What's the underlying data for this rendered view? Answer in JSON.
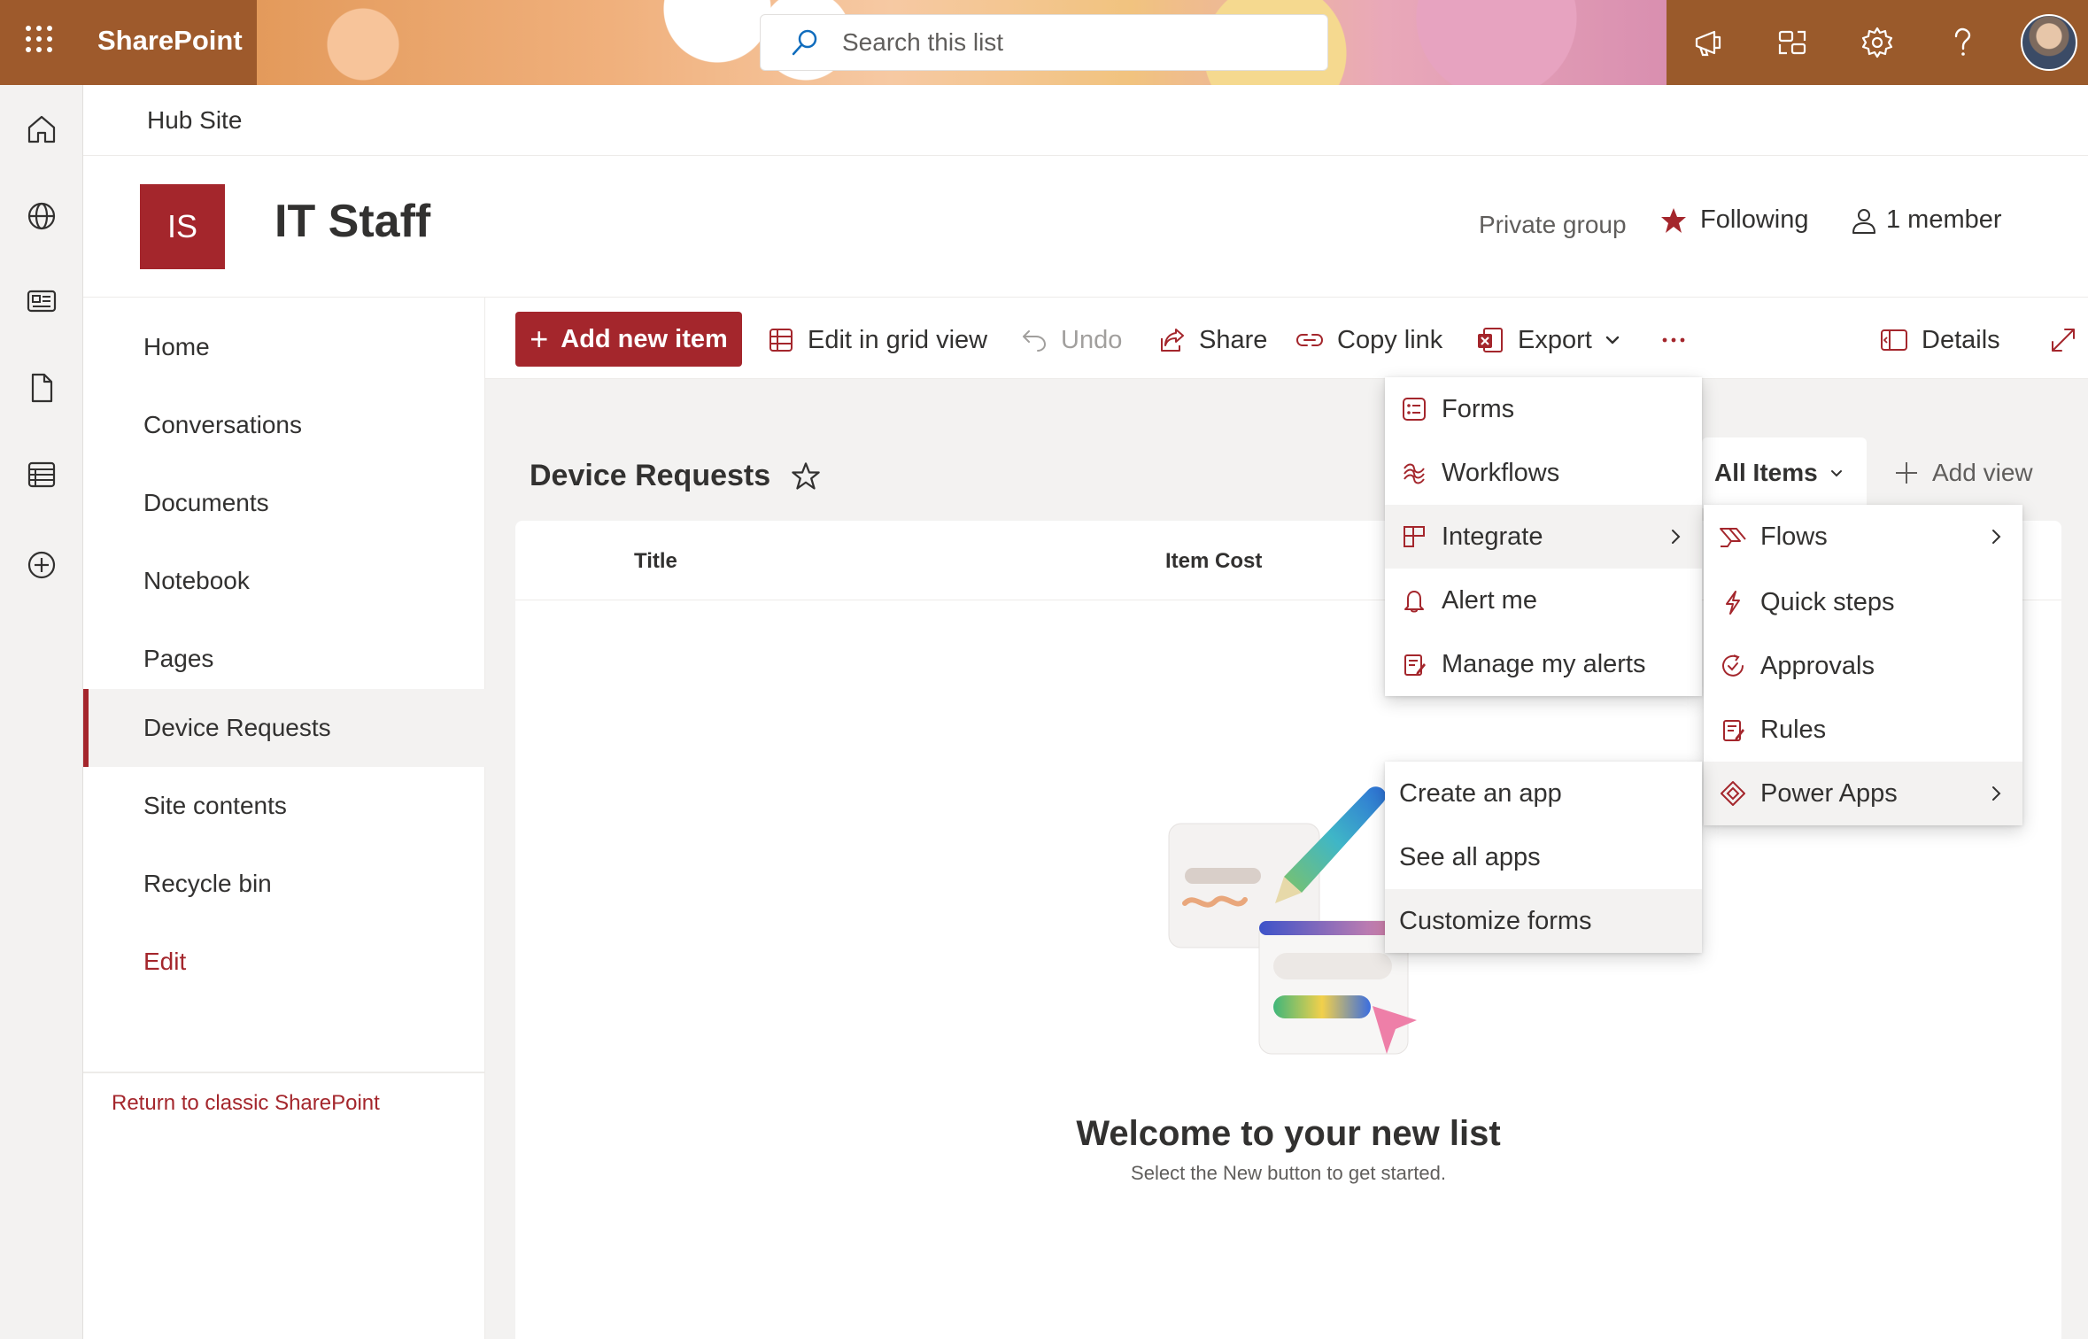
{
  "suite": {
    "brand": "SharePoint",
    "search_placeholder": "Search this list"
  },
  "hub": {
    "name": "Hub Site"
  },
  "site": {
    "logo_initials": "IS",
    "title": "IT Staff",
    "privacy": "Private group",
    "following": "Following",
    "members": "1 member"
  },
  "nav": {
    "items": [
      "Home",
      "Conversations",
      "Documents",
      "Notebook",
      "Pages",
      "Device Requests",
      "Site contents",
      "Recycle bin"
    ],
    "selected": "Device Requests",
    "edit": "Edit",
    "return_classic": "Return to classic SharePoint"
  },
  "commands": {
    "add_new_item": "Add new item",
    "edit_grid": "Edit in grid view",
    "undo": "Undo",
    "share": "Share",
    "copy_link": "Copy link",
    "export": "Export",
    "more": "···",
    "details": "Details"
  },
  "list": {
    "title": "Device Requests",
    "view": "All Items",
    "add_view": "Add view",
    "columns": [
      "Title",
      "Item Cost"
    ],
    "welcome_title": "Welcome to your new list",
    "welcome_sub": "Select the New button to get started."
  },
  "menus": {
    "main": [
      "Forms",
      "Workflows",
      "Integrate",
      "Alert me",
      "Manage my alerts"
    ],
    "integrate": [
      "Flows",
      "Quick steps",
      "Approvals",
      "Rules",
      "Power Apps"
    ],
    "power_apps": [
      "Create an app",
      "See all apps",
      "Customize forms"
    ]
  },
  "colors": {
    "accent": "#a4262c",
    "suitebar": "#9e5a2c"
  }
}
